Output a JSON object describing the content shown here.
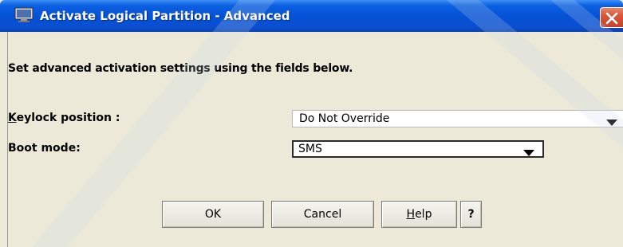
{
  "window": {
    "title": "Activate Logical Partition - Advanced",
    "title_bar_color": "#0551d6",
    "close_button_color": "#d8573a",
    "background_color": "#ece9d8"
  },
  "dialog": {
    "instructions": "Set advanced activation settings using the fields below.",
    "keylock": {
      "label": "Keylock position :",
      "selected_value": "Do Not Override"
    },
    "boot_mode": {
      "label": "Boot mode:",
      "selected_value": "SMS"
    }
  },
  "buttons": {
    "ok_label": "OK",
    "cancel_label": "Cancel",
    "help_mnemonic": "H",
    "help_rest": "elp",
    "question_label": "?"
  },
  "icons": {
    "app_icon": "monitor-icon",
    "close_icon": "close-x-icon",
    "dropdown_icon": "chevron-down-icon"
  }
}
